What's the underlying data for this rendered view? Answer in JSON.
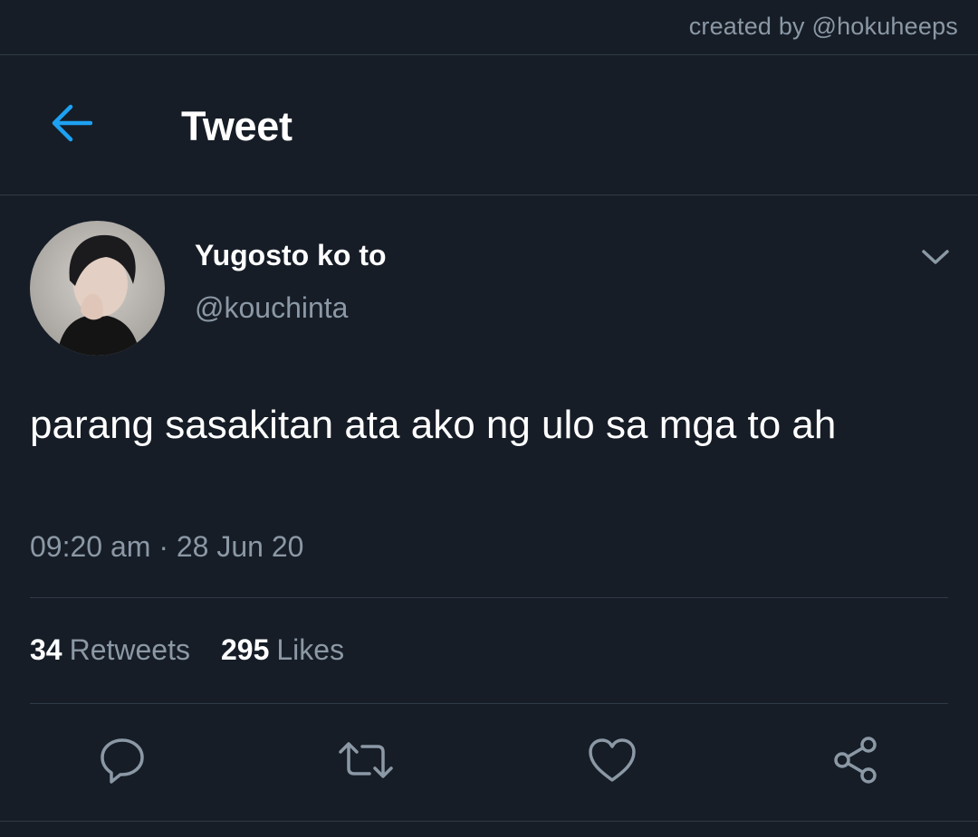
{
  "watermark": {
    "text": "created by @hokuheeps"
  },
  "header": {
    "title": "Tweet",
    "back_icon": "arrow-left-icon",
    "accent_color": "#1da1f2"
  },
  "tweet": {
    "author": {
      "display_name": "Yugosto ko to",
      "handle": "@kouchinta"
    },
    "more_icon": "chevron-down-icon",
    "text": "parang sasakitan ata ako ng ulo sa mga to ah",
    "timestamp": "09:20 am · 28 Jun 20",
    "stats": {
      "retweets": {
        "count": "34",
        "label": "Retweets"
      },
      "likes": {
        "count": "295",
        "label": "Likes"
      }
    },
    "actions": [
      {
        "name": "reply",
        "icon": "reply-icon"
      },
      {
        "name": "retweet",
        "icon": "retweet-icon"
      },
      {
        "name": "like",
        "icon": "heart-icon"
      },
      {
        "name": "share",
        "icon": "share-icon"
      }
    ]
  },
  "colors": {
    "background": "#161d27",
    "text_primary": "#ffffff",
    "text_secondary": "#8b98a5",
    "divider": "#2f3a46",
    "icon": "#8b98a5"
  }
}
